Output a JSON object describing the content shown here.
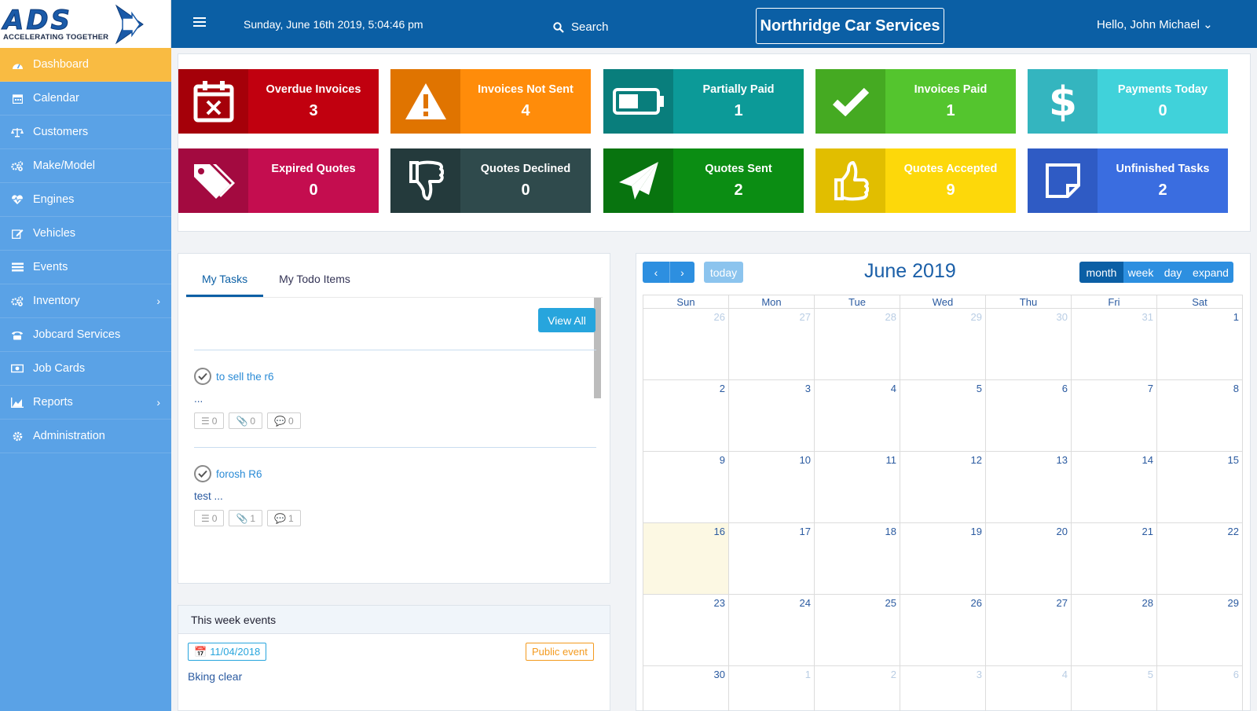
{
  "app": {
    "logo_text": "ADS",
    "tagline": "ACCELERATING TOGETHER"
  },
  "topbar": {
    "datetime": "Sunday, June 16th 2019, 5:04:46 pm",
    "search_label": "Search",
    "company": "Northridge Car Services",
    "user_greeting": "Hello, John Michael ⌄"
  },
  "sidebar": {
    "items": [
      {
        "label": "Dashboard",
        "icon": "dashboard-icon",
        "active": true
      },
      {
        "label": "Calendar",
        "icon": "calendar-icon"
      },
      {
        "label": "Customers",
        "icon": "balance-scale-icon"
      },
      {
        "label": "Make/Model",
        "icon": "cogs-icon"
      },
      {
        "label": "Engines",
        "icon": "heartbeat-icon"
      },
      {
        "label": "Vehicles",
        "icon": "edit-icon"
      },
      {
        "label": "Events",
        "icon": "list-icon"
      },
      {
        "label": "Inventory",
        "icon": "cogs-icon",
        "submenu": true
      },
      {
        "label": "Jobcard Services",
        "icon": "phone-icon"
      },
      {
        "label": "Job Cards",
        "icon": "money-icon"
      },
      {
        "label": "Reports",
        "icon": "area-chart-icon",
        "submenu": true
      },
      {
        "label": "Administration",
        "icon": "gear-icon"
      }
    ]
  },
  "stats": [
    {
      "label": "Overdue Invoices",
      "value": "3",
      "icon": "calendar-x-icon",
      "color": "#c1000f",
      "dark": "#a50009"
    },
    {
      "label": "Invoices Not Sent",
      "value": "4",
      "icon": "warning-icon",
      "color": "#ff8c0a",
      "dark": "#e07400"
    },
    {
      "label": "Partially Paid",
      "value": "1",
      "icon": "battery-half-icon",
      "color": "#0c9a98",
      "dark": "#097e7c"
    },
    {
      "label": "Invoices Paid",
      "value": "1",
      "icon": "check-icon",
      "color": "#54c52e",
      "dark": "#45aa22"
    },
    {
      "label": "Payments Today",
      "value": "0",
      "icon": "dollar-icon",
      "color": "#40d2da",
      "dark": "#34b5bf"
    },
    {
      "label": "Expired Quotes",
      "value": "0",
      "icon": "tags-icon",
      "color": "#c40d4f",
      "dark": "#a30a40"
    },
    {
      "label": "Quotes Declined",
      "value": "0",
      "icon": "thumbs-down-icon",
      "color": "#2f4a4c",
      "dark": "#243a3c"
    },
    {
      "label": "Quotes Sent",
      "value": "2",
      "icon": "paper-plane-icon",
      "color": "#0b8d13",
      "dark": "#08740f"
    },
    {
      "label": "Quotes Accepted",
      "value": "9",
      "icon": "thumbs-up-icon",
      "color": "#fdd80a",
      "dark": "#e1be00"
    },
    {
      "label": "Unfinished Tasks",
      "value": "2",
      "icon": "sticky-note-icon",
      "color": "#3a6de0",
      "dark": "#2f5bc4"
    }
  ],
  "tasks": {
    "tabs": [
      "My Tasks",
      "My Todo Items"
    ],
    "view_all": "View All",
    "items": [
      {
        "title": "to sell the r6",
        "desc": "...",
        "checklist": "0",
        "attachments": "0",
        "comments": "0"
      },
      {
        "title": "forosh R6",
        "desc": "test ...",
        "checklist": "0",
        "attachments": "1",
        "comments": "1"
      }
    ]
  },
  "events": {
    "heading": "This week events",
    "items": [
      {
        "date": "11/04/2018",
        "type": "Public event",
        "name": "Bking clear"
      }
    ]
  },
  "calendar": {
    "title": "June 2019",
    "today_label": "today",
    "prev_label": "‹",
    "next_label": "›",
    "views": [
      "month",
      "week",
      "day",
      "expand"
    ],
    "active_view": "month",
    "weekdays": [
      "Sun",
      "Mon",
      "Tue",
      "Wed",
      "Thu",
      "Fri",
      "Sat"
    ],
    "weeks": [
      [
        {
          "d": "26",
          "o": 1
        },
        {
          "d": "27",
          "o": 1
        },
        {
          "d": "28",
          "o": 1
        },
        {
          "d": "29",
          "o": 1
        },
        {
          "d": "30",
          "o": 1
        },
        {
          "d": "31",
          "o": 1
        },
        {
          "d": "1"
        }
      ],
      [
        {
          "d": "2"
        },
        {
          "d": "3"
        },
        {
          "d": "4"
        },
        {
          "d": "5"
        },
        {
          "d": "6"
        },
        {
          "d": "7"
        },
        {
          "d": "8"
        }
      ],
      [
        {
          "d": "9"
        },
        {
          "d": "10"
        },
        {
          "d": "11"
        },
        {
          "d": "12"
        },
        {
          "d": "13"
        },
        {
          "d": "14"
        },
        {
          "d": "15"
        }
      ],
      [
        {
          "d": "16",
          "t": 1
        },
        {
          "d": "17"
        },
        {
          "d": "18"
        },
        {
          "d": "19"
        },
        {
          "d": "20"
        },
        {
          "d": "21"
        },
        {
          "d": "22"
        }
      ],
      [
        {
          "d": "23"
        },
        {
          "d": "24"
        },
        {
          "d": "25"
        },
        {
          "d": "26"
        },
        {
          "d": "27"
        },
        {
          "d": "28"
        },
        {
          "d": "29"
        }
      ],
      [
        {
          "d": "30"
        },
        {
          "d": "1",
          "o": 1
        },
        {
          "d": "2",
          "o": 1
        },
        {
          "d": "3",
          "o": 1
        },
        {
          "d": "4",
          "o": 1
        },
        {
          "d": "5",
          "o": 1
        },
        {
          "d": "6",
          "o": 1
        }
      ]
    ]
  }
}
